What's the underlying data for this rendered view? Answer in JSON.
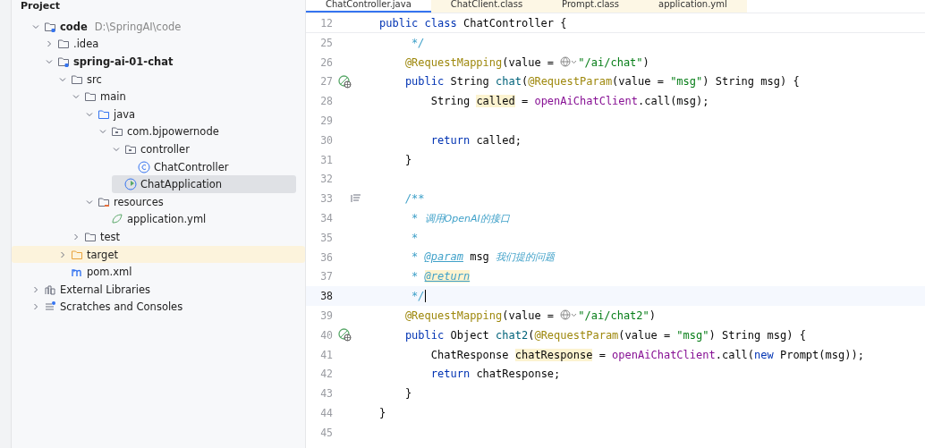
{
  "project_panel": {
    "title": "Project",
    "tree": [
      {
        "label": "code",
        "hint": "D:\\SpringAI\\code",
        "kind": "module",
        "expanded": true,
        "selected": false,
        "highlighted": false,
        "children": [
          {
            "label": ".idea",
            "kind": "folder",
            "expanded": false,
            "selected": false,
            "highlighted": false
          },
          {
            "label": "spring-ai-01-chat",
            "kind": "module",
            "expanded": true,
            "selected": false,
            "highlighted": false,
            "children": [
              {
                "label": "src",
                "kind": "folder",
                "expanded": true,
                "selected": false,
                "highlighted": false,
                "children": [
                  {
                    "label": "main",
                    "kind": "folder",
                    "expanded": true,
                    "selected": false,
                    "highlighted": false,
                    "children": [
                      {
                        "label": "java",
                        "kind": "source",
                        "expanded": true,
                        "selected": false,
                        "highlighted": false,
                        "children": [
                          {
                            "label": "com.bjpowernode",
                            "kind": "package",
                            "expanded": true,
                            "selected": false,
                            "highlighted": false,
                            "children": [
                              {
                                "label": "controller",
                                "kind": "package",
                                "expanded": true,
                                "selected": false,
                                "highlighted": false,
                                "children": [
                                  {
                                    "label": "ChatController",
                                    "kind": "class",
                                    "selected": false,
                                    "highlighted": false
                                  }
                                ]
                              },
                              {
                                "label": "ChatApplication",
                                "kind": "app",
                                "selected": true,
                                "highlighted": false
                              }
                            ]
                          }
                        ]
                      },
                      {
                        "label": "resources",
                        "kind": "resources",
                        "expanded": true,
                        "selected": false,
                        "highlighted": false,
                        "children": [
                          {
                            "label": "application.yml",
                            "kind": "yml",
                            "selected": false,
                            "highlighted": false
                          }
                        ]
                      }
                    ]
                  },
                  {
                    "label": "test",
                    "kind": "folder",
                    "expanded": false,
                    "selected": false,
                    "highlighted": false
                  }
                ]
              },
              {
                "label": "target",
                "kind": "excluded",
                "expanded": false,
                "selected": false,
                "highlighted": true
              },
              {
                "label": "pom.xml",
                "kind": "maven",
                "selected": false,
                "highlighted": false
              }
            ]
          }
        ]
      },
      {
        "label": "External Libraries",
        "kind": "library",
        "expanded": false,
        "selected": false,
        "highlighted": false
      },
      {
        "label": "Scratches and Consoles",
        "kind": "scratch",
        "expanded": false,
        "selected": false,
        "highlighted": false
      }
    ]
  },
  "editor": {
    "tabs": [
      {
        "label": "ChatController.java",
        "selected": true
      },
      {
        "label": "ChatClient.class",
        "selected": false
      },
      {
        "label": "Prompt.class",
        "selected": false
      },
      {
        "label": "application.yml",
        "selected": false
      }
    ],
    "sticky_line": {
      "number": "12",
      "tokens": [
        {
          "kind": "kw",
          "text": "public class"
        },
        {
          "kind": "plain",
          "text": " ChatController {"
        }
      ]
    },
    "lines": [
      {
        "number": "25",
        "current": false,
        "tokens": [
          {
            "kind": "comment",
            "text": "     */"
          }
        ]
      },
      {
        "number": "26",
        "current": false,
        "tokens": [
          {
            "kind": "ann",
            "text": "    @RequestMapping"
          },
          {
            "kind": "plain",
            "text": "(value = "
          },
          {
            "kind": "globe"
          },
          {
            "kind": "str",
            "text": "\"/ai/chat\""
          },
          {
            "kind": "plain",
            "text": ")"
          }
        ]
      },
      {
        "number": "27",
        "gutter": {
          "kind": "endpoint"
        },
        "current": false,
        "tokens": [
          {
            "kind": "kw",
            "text": "    public"
          },
          {
            "kind": "plain",
            "text": " String "
          },
          {
            "kind": "fn",
            "text": "chat"
          },
          {
            "kind": "plain",
            "text": "("
          },
          {
            "kind": "ann",
            "text": "@RequestParam"
          },
          {
            "kind": "plain",
            "text": "(value = "
          },
          {
            "kind": "str",
            "text": "\"msg\""
          },
          {
            "kind": "plain",
            "text": ") String msg) {"
          }
        ]
      },
      {
        "number": "28",
        "current": false,
        "tokens": [
          {
            "kind": "plain",
            "text": "        String "
          },
          {
            "kind": "mark",
            "text": "called"
          },
          {
            "kind": "plain",
            "text": " = "
          },
          {
            "kind": "field",
            "text": "openAiChatClient"
          },
          {
            "kind": "plain",
            "text": ".call(msg);"
          }
        ]
      },
      {
        "number": "29",
        "current": false
      },
      {
        "number": "30",
        "current": false,
        "tokens": [
          {
            "kind": "kw",
            "text": "        return"
          },
          {
            "kind": "plain",
            "text": " called;"
          }
        ]
      },
      {
        "number": "31",
        "current": false,
        "tokens": [
          {
            "kind": "plain",
            "text": "    }"
          }
        ]
      },
      {
        "number": "32",
        "current": false
      },
      {
        "number": "33",
        "gutter": {
          "kind": "doc"
        },
        "current": false,
        "tokens": [
          {
            "kind": "comment",
            "text": "    /**"
          }
        ]
      },
      {
        "number": "34",
        "current": false,
        "tokens": [
          {
            "kind": "comment",
            "text": "     * "
          },
          {
            "kind": "doc",
            "text": "调用OpenAI的接口"
          }
        ]
      },
      {
        "number": "35",
        "current": false,
        "tokens": [
          {
            "kind": "comment",
            "text": "     *"
          }
        ]
      },
      {
        "number": "36",
        "current": false,
        "tokens": [
          {
            "kind": "comment",
            "text": "     * "
          },
          {
            "kind": "tag",
            "text": "@param"
          },
          {
            "kind": "plain",
            "text": " msg "
          },
          {
            "kind": "doc",
            "text": "我们提的问题"
          }
        ]
      },
      {
        "number": "37",
        "current": false,
        "tokens": [
          {
            "kind": "comment",
            "text": "     * "
          },
          {
            "kind": "tagmark",
            "text": "@return"
          }
        ]
      },
      {
        "number": "38",
        "current": true,
        "tokens": [
          {
            "kind": "comment",
            "text": "     */"
          }
        ]
      },
      {
        "number": "39",
        "current": false,
        "tokens": [
          {
            "kind": "ann",
            "text": "    @RequestMapping"
          },
          {
            "kind": "plain",
            "text": "(value = "
          },
          {
            "kind": "globe"
          },
          {
            "kind": "str",
            "text": "\"/ai/chat2\""
          },
          {
            "kind": "plain",
            "text": ")"
          }
        ]
      },
      {
        "number": "40",
        "gutter": {
          "kind": "endpoint"
        },
        "current": false,
        "tokens": [
          {
            "kind": "kw",
            "text": "    public"
          },
          {
            "kind": "plain",
            "text": " Object "
          },
          {
            "kind": "fn",
            "text": "chat2"
          },
          {
            "kind": "plain",
            "text": "("
          },
          {
            "kind": "ann",
            "text": "@RequestParam"
          },
          {
            "kind": "plain",
            "text": "(value = "
          },
          {
            "kind": "str",
            "text": "\"msg\""
          },
          {
            "kind": "plain",
            "text": ") String msg) {"
          }
        ]
      },
      {
        "number": "41",
        "current": false,
        "tokens": [
          {
            "kind": "plain",
            "text": "        ChatResponse "
          },
          {
            "kind": "mark",
            "text": "chatResponse"
          },
          {
            "kind": "plain",
            "text": " = "
          },
          {
            "kind": "field",
            "text": "openAiChatClient"
          },
          {
            "kind": "plain",
            "text": ".call("
          },
          {
            "kind": "kw",
            "text": "new"
          },
          {
            "kind": "plain",
            "text": " Prompt(msg));"
          }
        ]
      },
      {
        "number": "42",
        "current": false,
        "tokens": [
          {
            "kind": "kw",
            "text": "        return"
          },
          {
            "kind": "plain",
            "text": " chatResponse;"
          }
        ]
      },
      {
        "number": "43",
        "current": false,
        "tokens": [
          {
            "kind": "plain",
            "text": "    }"
          }
        ]
      },
      {
        "number": "44",
        "current": false,
        "tokens": [
          {
            "kind": "plain",
            "text": "}"
          }
        ]
      },
      {
        "number": "45",
        "current": false
      }
    ]
  }
}
